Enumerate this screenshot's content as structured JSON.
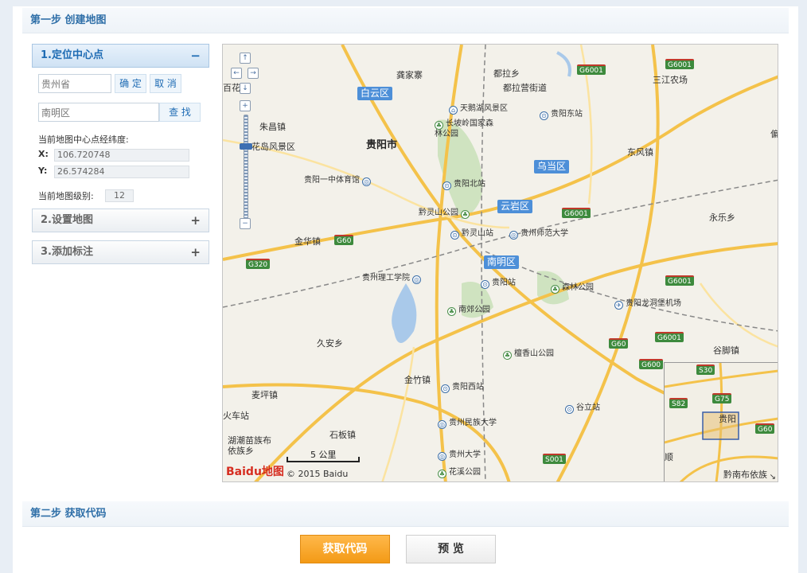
{
  "step1": {
    "title": "第一步 创建地图"
  },
  "step2": {
    "title": "第二步 获取代码"
  },
  "sidebar": {
    "section1": {
      "title": "1.定位中心点",
      "toggle": "−"
    },
    "section2": {
      "title": "2.设置地图",
      "toggle": "+"
    },
    "section3": {
      "title": "3.添加标注",
      "toggle": "+"
    },
    "province_input": {
      "value": "贵州省"
    },
    "confirm_label": "确 定",
    "cancel_label": "取 消",
    "district_input": {
      "value": "南明区"
    },
    "search_label": "查 找",
    "center_label": "当前地图中心点经纬度:",
    "x_label": "X:",
    "x_value": "106.720748",
    "y_label": "Y:",
    "y_value": "26.574284",
    "zoom_label": "当前地图级别:",
    "zoom_value": "12"
  },
  "map": {
    "city_label": "贵阳市",
    "districts": [
      "白云区",
      "乌当区",
      "云岩区",
      "南明区"
    ],
    "places": [
      "龚家寨",
      "都拉乡",
      "都拉营街道",
      "三江农场",
      "百花",
      "朱昌镇",
      "花岛风景区",
      "东风镇",
      "永乐乡",
      "金华镇",
      "久安乡",
      "麦坪镇",
      "火车站",
      "湖潮苗族布依族乡",
      "石板镇",
      "金竹镇",
      "谷脚镇",
      "偏"
    ],
    "pois": [
      "天鹅湖风景区",
      "贵阳东站",
      "长坡岭国家森林公园",
      "贵阳一中体育馆",
      "贵阳北站",
      "黔灵山公园",
      "黔灵山站",
      "贵州师范大学",
      "贵州理工学院",
      "贵阳站",
      "森林公园",
      "贵阳龙洞堡机场",
      "南郊公园",
      "贵阳西站",
      "檀香山公园",
      "谷立站",
      "贵州民族大学",
      "贵州大学",
      "花溪公园"
    ],
    "highways": [
      "G6001",
      "G6001",
      "G6001",
      "G6001",
      "G6001",
      "G60",
      "G60",
      "G320",
      "S001",
      "G600"
    ],
    "scale_label": "5 公里",
    "logo_text": "Baidu地图",
    "copyright": "© 2015 Baidu",
    "overview": {
      "labels": [
        "S30",
        "G75",
        "S82",
        "贵阳",
        "G60",
        "黔南布依族",
        "顺"
      ]
    }
  },
  "buttons": {
    "get_code": "获取代码",
    "preview": "预 览"
  },
  "colors": {
    "accent": "#2f6fa8",
    "primary_button": "#f39a16",
    "district_badge": "#4d8fd8",
    "highway_badge": "#3d8a3d"
  }
}
